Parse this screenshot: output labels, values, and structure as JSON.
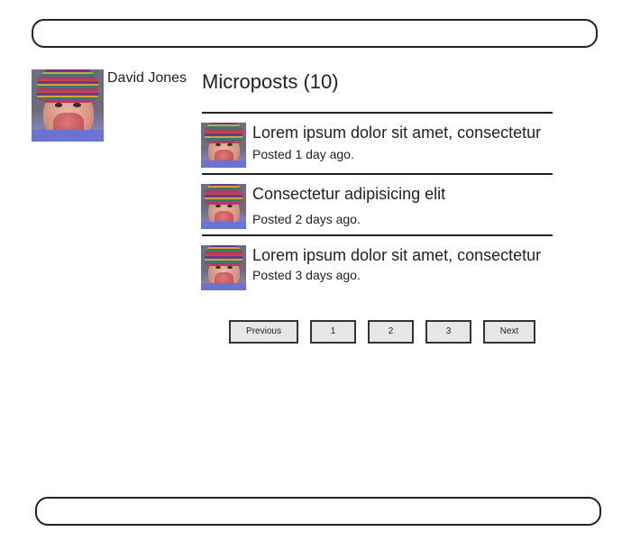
{
  "profile": {
    "name": "David Jones",
    "avatar_icon": "user-avatar-photo"
  },
  "microposts": {
    "heading": "Microposts (10)",
    "items": [
      {
        "content": "Lorem ipsum dolor sit amet, consectetur",
        "timestamp": "Posted 1 day ago."
      },
      {
        "content": "Consectetur adipisicing elit",
        "timestamp": "Posted 2 days ago."
      },
      {
        "content": "Lorem ipsum dolor sit amet, consectetur",
        "timestamp": "Posted 3 days ago."
      }
    ]
  },
  "pagination": {
    "previous_label": "Previous",
    "pages": [
      "1",
      "2",
      "3"
    ],
    "next_label": "Next"
  },
  "colors": {
    "border": "#222222",
    "button_bg": "#e6e6e6",
    "text": "#222222"
  }
}
